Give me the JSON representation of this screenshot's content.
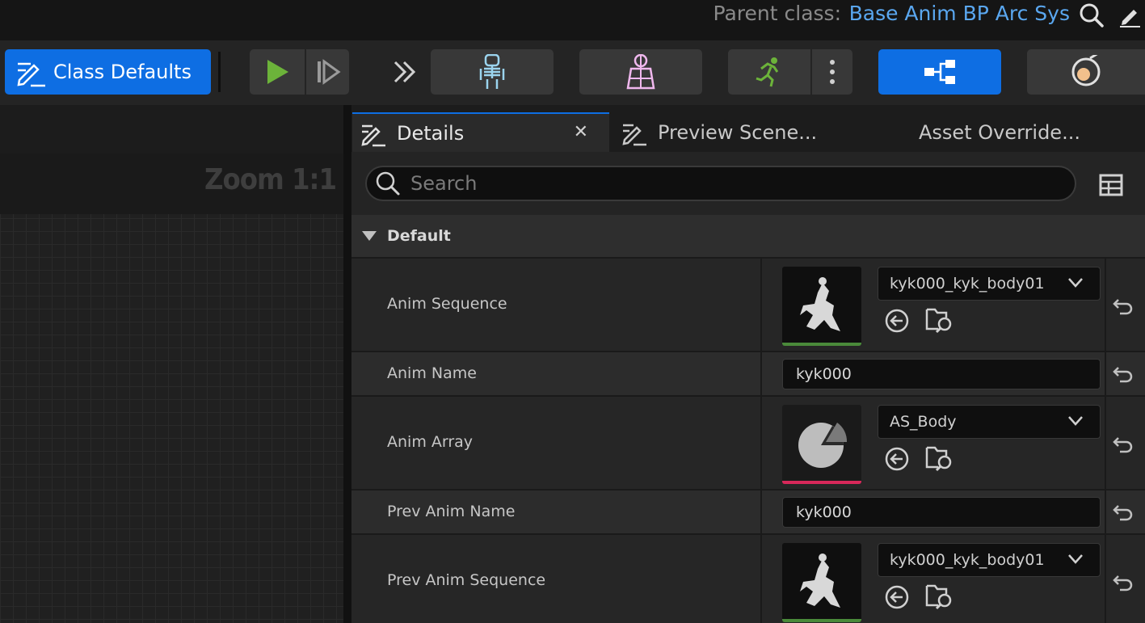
{
  "header": {
    "parent_class_label": "Parent class:",
    "parent_class_value": "Base Anim BP Arc Sys"
  },
  "toolbar": {
    "class_defaults_label": "Class Defaults"
  },
  "graph": {
    "zoom_label": "Zoom 1:1"
  },
  "tabs": [
    {
      "label": "Details",
      "active": true
    },
    {
      "label": "Preview Scene..."
    },
    {
      "label": "Asset Override..."
    }
  ],
  "search": {
    "placeholder": "Search"
  },
  "category": {
    "label": "Default"
  },
  "properties": [
    {
      "name": "Anim Sequence",
      "type": "asset",
      "value": "kyk000_kyk_body01",
      "bar_color": "#4a8a3a"
    },
    {
      "name": "Anim Name",
      "type": "text",
      "value": "kyk000"
    },
    {
      "name": "Anim Array",
      "type": "asset",
      "value": "AS_Body",
      "bar_color": "#d8285a"
    },
    {
      "name": "Prev Anim Name",
      "type": "text",
      "value": "kyk000"
    },
    {
      "name": "Prev Anim Sequence",
      "type": "asset",
      "value": "kyk000_kyk_body01",
      "bar_color": "#4a8a3a"
    }
  ],
  "colors": {
    "accent": "#0e6ee3",
    "link": "#5aa7f0",
    "play_green": "#6cb33a"
  }
}
